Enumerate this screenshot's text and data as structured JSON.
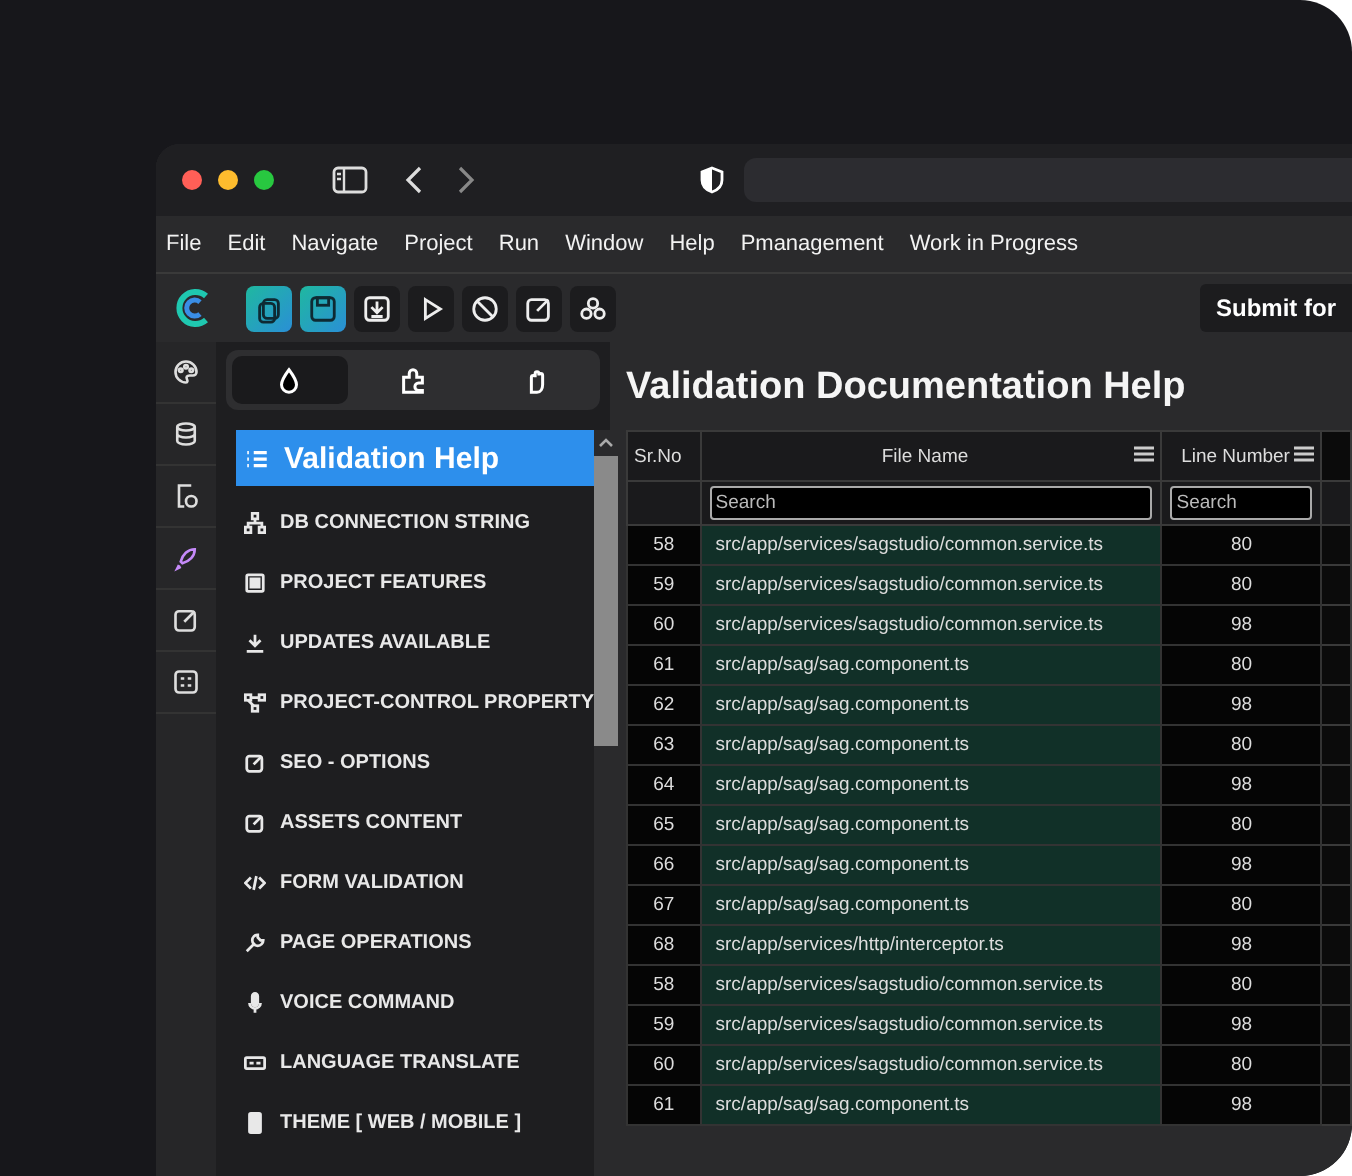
{
  "menu": [
    "File",
    "Edit",
    "Navigate",
    "Project",
    "Run",
    "Window",
    "Help",
    "Pmanagement",
    "Work in Progress"
  ],
  "toolbar_buttons": [
    {
      "highlighted": true
    },
    {
      "highlighted": true
    },
    {
      "highlighted": false
    },
    {
      "highlighted": false
    },
    {
      "highlighted": false
    },
    {
      "highlighted": false
    },
    {
      "highlighted": false
    }
  ],
  "submit_button": "Submit for",
  "panel_tabs": [
    {
      "selected": true
    },
    {
      "selected": false
    },
    {
      "selected": false
    }
  ],
  "nav_items": [
    {
      "label": "Validation Help",
      "selected": true
    },
    {
      "label": "DB CONNECTION STRING",
      "selected": false
    },
    {
      "label": "PROJECT FEATURES",
      "selected": false
    },
    {
      "label": "UPDATES AVAILABLE",
      "selected": false
    },
    {
      "label": "PROJECT-CONTROL PROPERTY",
      "selected": false
    },
    {
      "label": "SEO - OPTIONS",
      "selected": false
    },
    {
      "label": "ASSETS CONTENT",
      "selected": false
    },
    {
      "label": "FORM VALIDATION",
      "selected": false
    },
    {
      "label": "PAGE OPERATIONS",
      "selected": false
    },
    {
      "label": "VOICE COMMAND",
      "selected": false
    },
    {
      "label": "LANGUAGE TRANSLATE",
      "selected": false
    },
    {
      "label": "THEME [ WEB / MOBILE ]",
      "selected": false
    }
  ],
  "content": {
    "title": "Validation Documentation Help",
    "table": {
      "columns": [
        "Sr.No",
        "File Name",
        "Line Number"
      ],
      "search_placeholders": [
        "Search",
        "Search"
      ],
      "rows": [
        {
          "sr": "58",
          "file": "src/app/services/sagstudio/common.service.ts",
          "line": "80"
        },
        {
          "sr": "59",
          "file": "src/app/services/sagstudio/common.service.ts",
          "line": "80"
        },
        {
          "sr": "60",
          "file": "src/app/services/sagstudio/common.service.ts",
          "line": "98"
        },
        {
          "sr": "61",
          "file": "src/app/sag/sag.component.ts",
          "line": "80"
        },
        {
          "sr": "62",
          "file": "src/app/sag/sag.component.ts",
          "line": "98"
        },
        {
          "sr": "63",
          "file": "src/app/sag/sag.component.ts",
          "line": "80"
        },
        {
          "sr": "64",
          "file": "src/app/sag/sag.component.ts",
          "line": "98"
        },
        {
          "sr": "65",
          "file": "src/app/sag/sag.component.ts",
          "line": "80"
        },
        {
          "sr": "66",
          "file": "src/app/sag/sag.component.ts",
          "line": "98"
        },
        {
          "sr": "67",
          "file": "src/app/sag/sag.component.ts",
          "line": "80"
        },
        {
          "sr": "68",
          "file": "src/app/services/http/interceptor.ts",
          "line": "98"
        },
        {
          "sr": "58",
          "file": "src/app/services/sagstudio/common.service.ts",
          "line": "80"
        },
        {
          "sr": "59",
          "file": "src/app/services/sagstudio/common.service.ts",
          "line": "98"
        },
        {
          "sr": "60",
          "file": "src/app/services/sagstudio/common.service.ts",
          "line": "80"
        },
        {
          "sr": "61",
          "file": "src/app/sag/sag.component.ts",
          "line": "98"
        }
      ]
    }
  }
}
